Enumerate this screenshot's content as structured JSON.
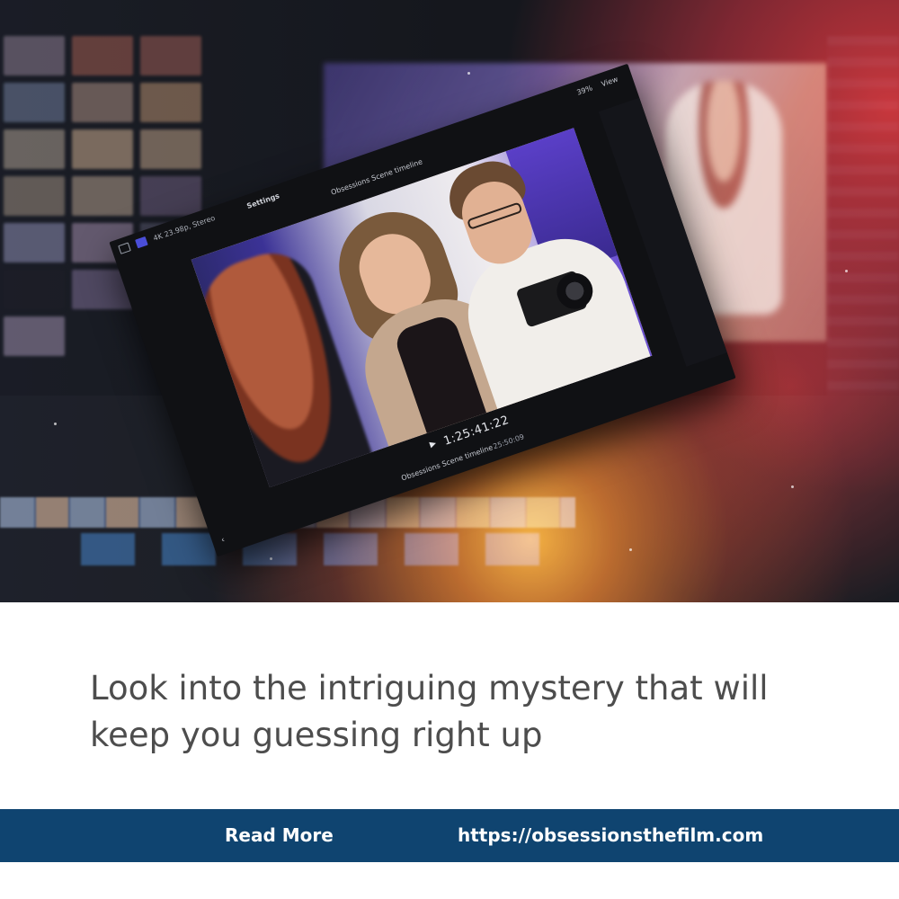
{
  "editor_screenshot": {
    "format_label": "4K 23.98p, Stereo",
    "settings_label": "Settings",
    "timeline_title": "Obsessions Scene timeline",
    "zoom_label": "39%",
    "view_label": "View",
    "timecode": "1:25:41:22",
    "timeline_selector": "Obsessions Scene timeline",
    "duration": "25:50:09"
  },
  "caption": {
    "line1": "Look into the intriguing mystery that will",
    "line2": "keep you guessing right up"
  },
  "footer": {
    "read_more_label": "Read More",
    "url_label": "https://obsessionsthefilm.com"
  },
  "colors": {
    "footer_bg": "#0f4470",
    "caption_text": "#4d4d4d",
    "accent_orange": "#f0a020",
    "accent_red": "#d52323"
  }
}
